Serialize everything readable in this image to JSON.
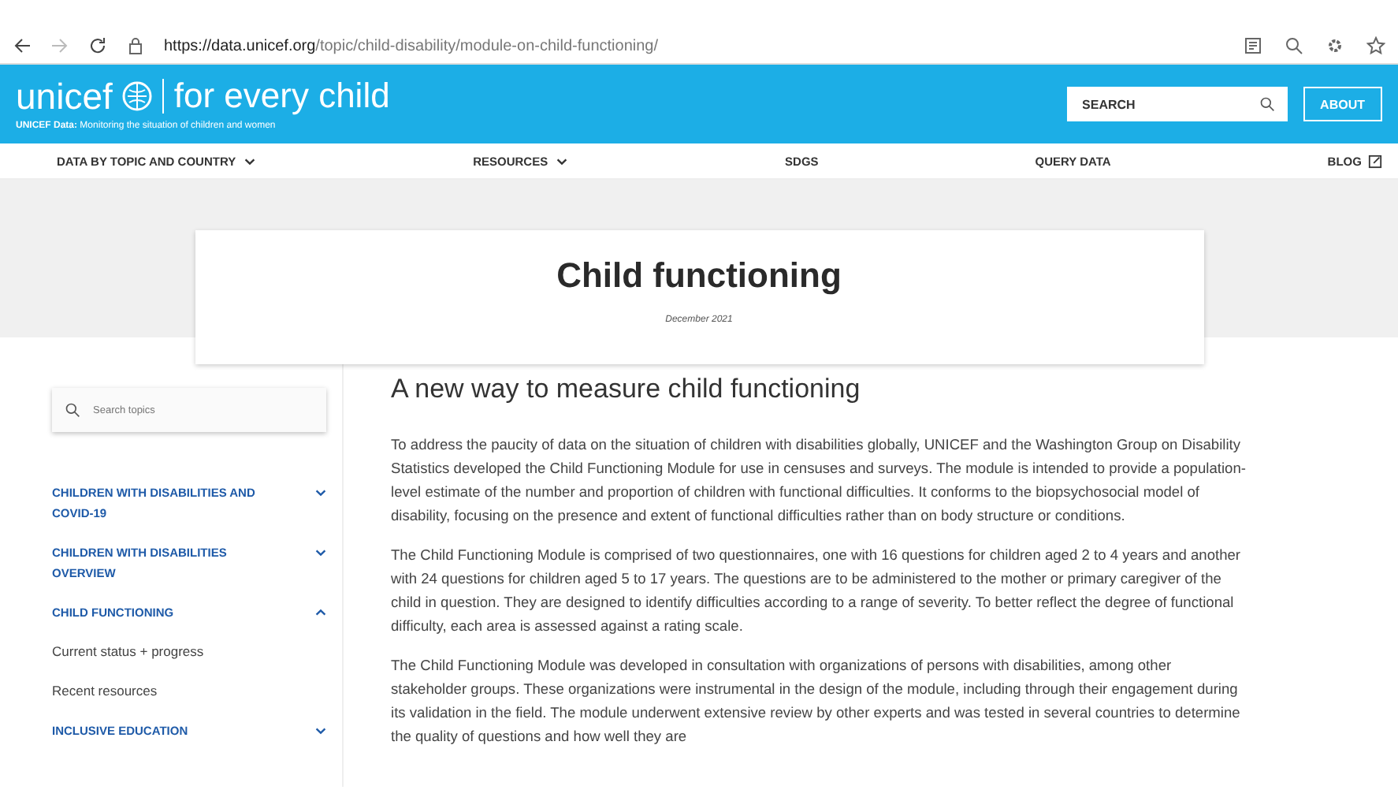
{
  "browser": {
    "url_host": "https://data.unicef.org",
    "url_path": "/topic/child-disability/module-on-child-functioning/"
  },
  "header": {
    "logo": "unicef",
    "tagline": "for every child",
    "subtitle_bold": "UNICEF Data:",
    "subtitle": "Monitoring the situation of children and women",
    "search": {
      "placeholder": "SEARCH"
    },
    "about": "ABOUT"
  },
  "nav": [
    {
      "label": "DATA BY TOPIC AND COUNTRY",
      "kind": "dropdown"
    },
    {
      "label": "RESOURCES",
      "kind": "dropdown"
    },
    {
      "label": "SDGS",
      "kind": "plain"
    },
    {
      "label": "QUERY DATA",
      "kind": "plain"
    },
    {
      "label": "BLOG",
      "kind": "external"
    }
  ],
  "hero": {
    "title": "Child functioning",
    "date": "December 2021"
  },
  "sidebar": {
    "search": {
      "placeholder": "Search topics"
    },
    "items": [
      {
        "label": "CHILDREN WITH DISABILITIES AND COVID-19",
        "kind": "section",
        "expanded": false
      },
      {
        "label": "CHILDREN WITH DISABILITIES OVERVIEW",
        "kind": "section",
        "expanded": false
      },
      {
        "label": "CHILD FUNCTIONING",
        "kind": "section",
        "expanded": true
      },
      {
        "label": "Current status + progress",
        "kind": "link"
      },
      {
        "label": "Recent resources",
        "kind": "link"
      },
      {
        "label": "INCLUSIVE EDUCATION",
        "kind": "section",
        "expanded": false
      }
    ]
  },
  "article": {
    "heading": "A new way to measure child functioning",
    "paragraphs": [
      "To address the paucity of data on the situation of children with disabilities globally, UNICEF and the Washington Group on Disability Statistics developed the Child Functioning Module for use in censuses and surveys. The module is intended to provide a population-level estimate of the number and proportion of children with functional difficulties. It conforms to the biopsychosocial model of disability, focusing on the presence and extent of functional difficulties rather than on body structure or conditions.",
      "The Child Functioning Module is comprised of two questionnaires, one with 16 questions for children aged 2 to 4 years and another with 24 questions for children aged 5 to 17 years. The questions are to be administered to the mother or primary caregiver of the child in question. They are designed to identify difficulties according to a range of severity. To better reflect the degree of functional difficulty, each area is assessed against a rating scale.",
      "The Child Functioning Module was developed in consultation with organizations of persons with disabilities, among other stakeholder groups. These organizations were instrumental in the design of the module, including through their engagement during its validation in the field. The module underwent extensive review by other experts and was tested in several countries to determine the quality of questions and how well they are"
    ]
  }
}
